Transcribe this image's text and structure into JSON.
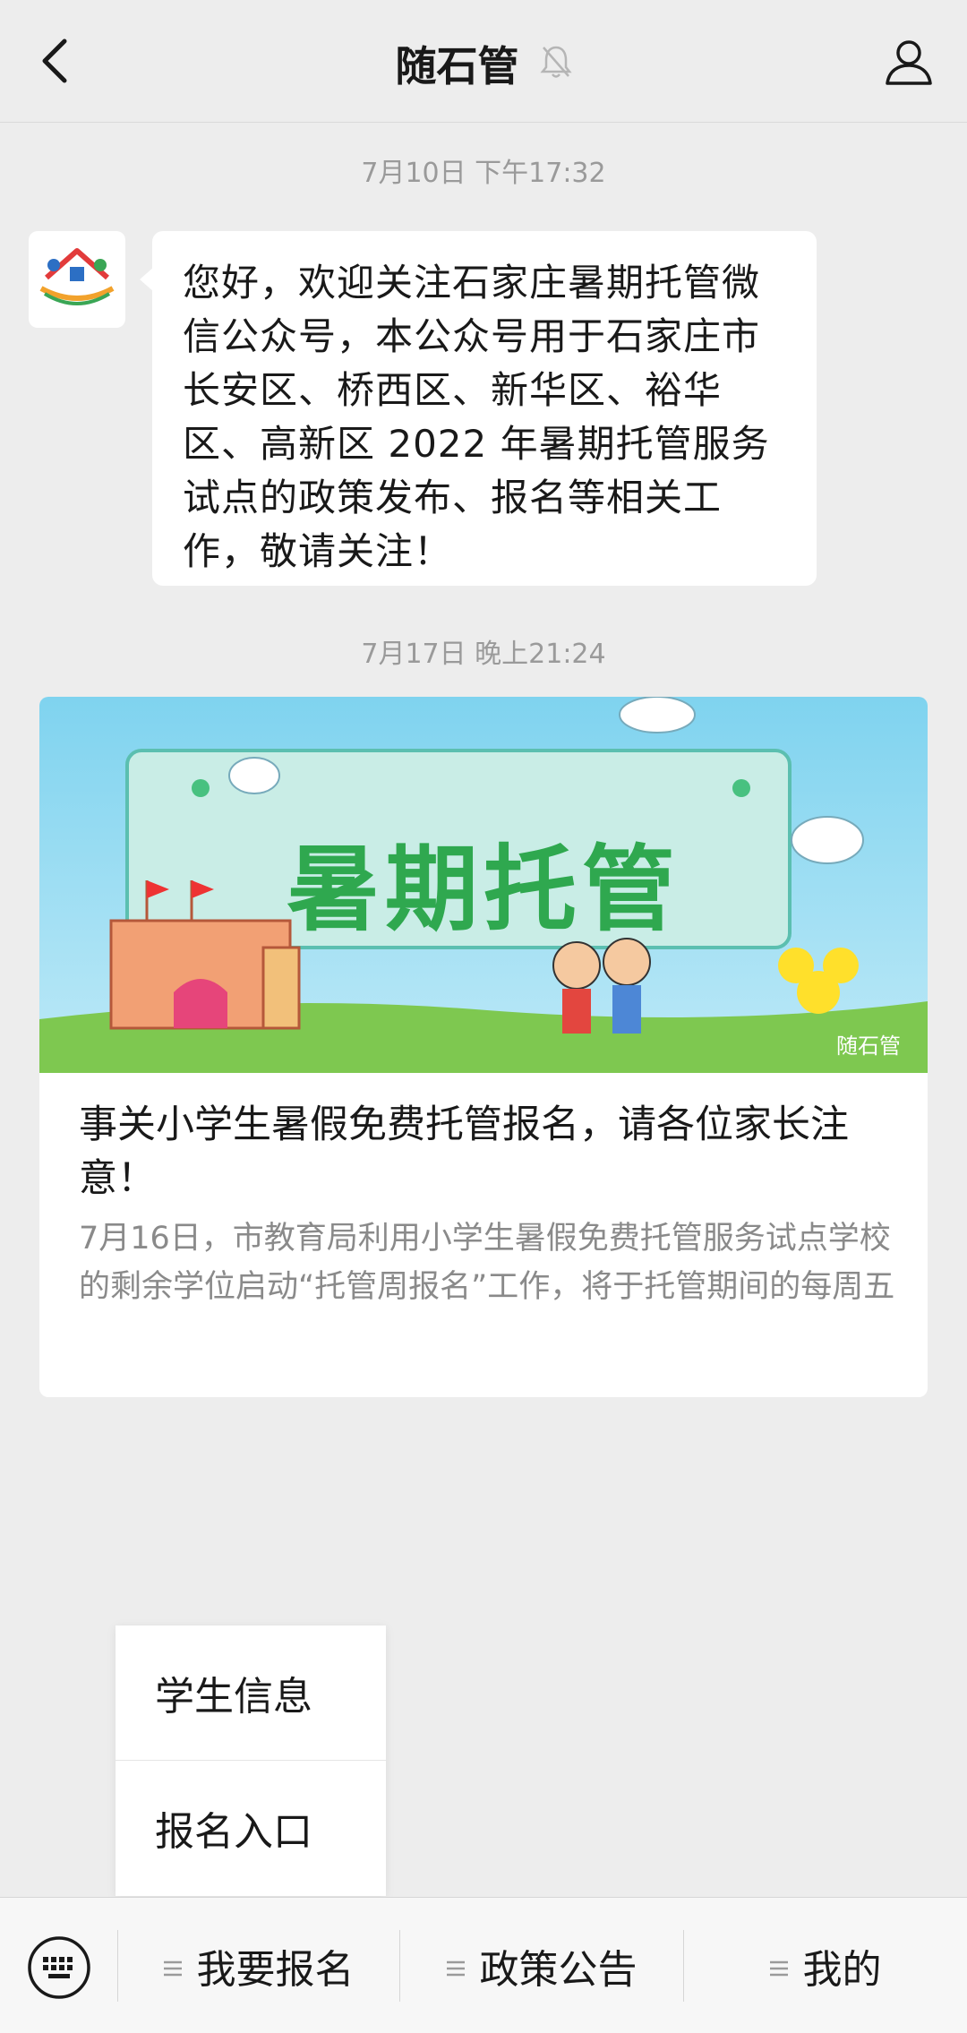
{
  "header": {
    "title": "随石管"
  },
  "messages": [
    {
      "timestamp": "7月10日 下午17:32",
      "text": "您好，欢迎关注石家庄暑期托管微信公众号，本公众号用于石家庄市长安区、桥西区、新华区、裕华区、高新区 2022 年暑期托管服务试点的政策发布、报名等相关工作，敬请关注！"
    },
    {
      "timestamp": "7月17日 晚上21:24"
    }
  ],
  "avatar": {
    "label": "随石管"
  },
  "article": {
    "banner_heading": "暑期托管",
    "banner_watermark": "随石管",
    "title": "事关小学生暑假免费托管报名，请各位家长注意！",
    "description": "7月16日，市教育局利用小学生暑假免费托管服务试点学校的剩余学位启动“托管周报名”工作，将于托管期间的每周五"
  },
  "popup_menu": {
    "items": [
      "学生信息",
      "报名入口"
    ]
  },
  "bottom_menu": {
    "items": [
      "我要报名",
      "政策公告",
      "我的"
    ]
  },
  "colors": {
    "background": "#ededed",
    "bubble": "#ffffff",
    "timestamp": "#9a9a9a",
    "banner_green": "#2fa84f"
  }
}
